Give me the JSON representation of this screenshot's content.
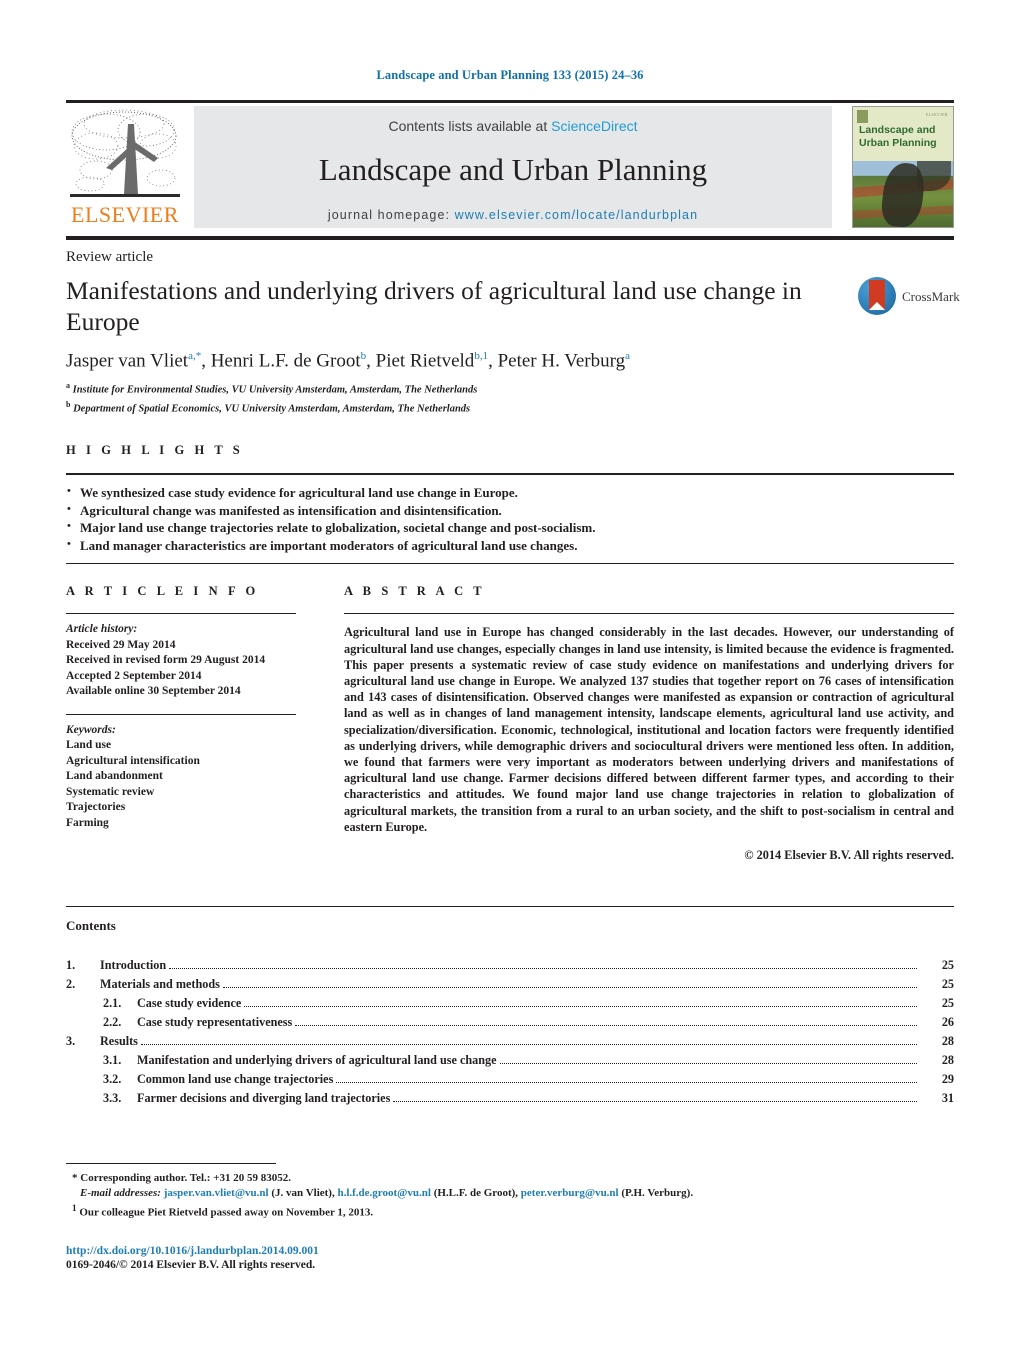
{
  "masthead": {
    "citation": "Landscape and Urban Planning 133 (2015) 24–36"
  },
  "journal_header": {
    "contents_prefix": "Contents lists available at ",
    "sciencedirect": "ScienceDirect",
    "journal_title": "Landscape and Urban Planning",
    "homepage_prefix": "journal homepage:",
    "homepage_url": "www.elsevier.com/locate/landurbplan",
    "publisher_wordmark": "ELSEVIER",
    "cover": {
      "line1": "Landscape and",
      "line2": "Urban Planning",
      "masthead_mini": "ELSEVIER"
    },
    "colors": {
      "link_blue": "#1f7db5",
      "sciencedirect_blue": "#1f9cd4",
      "elsevier_orange": "#f07c1a",
      "panel_grey": "#e6e7e8",
      "cover_green": "#2f6b2f"
    }
  },
  "article": {
    "type": "Review article",
    "title": "Manifestations and underlying drivers of agricultural land use change in Europe",
    "crossmark_label": "CrossMark",
    "authors_html": "Jasper van Vliet<sup>a,*</sup>, Henri L.F. de Groot<sup>b</sup>, Piet Rietveld<sup>b,1</sup>, Peter H. Verburg<sup>a</sup>",
    "affiliations": [
      "Institute for Environmental Studies, VU University Amsterdam, Amsterdam, The Netherlands",
      "Department of Spatial Economics, VU University Amsterdam, Amsterdam, The Netherlands"
    ],
    "affiliation_marks": [
      "a",
      "b"
    ]
  },
  "highlights": {
    "heading": "H I G H L I G H T S",
    "items": [
      "We synthesized case study evidence for agricultural land use change in Europe.",
      "Agricultural change was manifested as intensification and disintensification.",
      "Major land use change trajectories relate to globalization, societal change and post-socialism.",
      "Land manager characteristics are important moderators of agricultural land use changes."
    ]
  },
  "article_info": {
    "heading": "A R T I C L E    I N F O",
    "history_label": "Article history:",
    "history": [
      "Received 29 May 2014",
      "Received in revised form 29 August 2014",
      "Accepted 2 September 2014",
      "Available online 30 September 2014"
    ],
    "keywords_label": "Keywords:",
    "keywords": [
      "Land use",
      "Agricultural intensification",
      "Land abandonment",
      "Systematic review",
      "Trajectories",
      "Farming"
    ]
  },
  "abstract": {
    "heading": "A B S T R A C T",
    "text": "Agricultural land use in Europe has changed considerably in the last decades. However, our understanding of agricultural land use changes, especially changes in land use intensity, is limited because the evidence is fragmented. This paper presents a systematic review of case study evidence on manifestations and underlying drivers for agricultural land use change in Europe. We analyzed 137 studies that together report on 76 cases of intensification and 143 cases of disintensification. Observed changes were manifested as expansion or contraction of agricultural land as well as in changes of land management intensity, landscape elements, agricultural land use activity, and specialization/diversification. Economic, technological, institutional and location factors were frequently identified as underlying drivers, while demographic drivers and sociocultural drivers were mentioned less often. In addition, we found that farmers were very important as moderators between underlying drivers and manifestations of agricultural land use change. Farmer decisions differed between different farmer types, and according to their characteristics and attitudes. We found major land use change trajectories in relation to globalization of agricultural markets, the transition from a rural to an urban society, and the shift to post-socialism in central and eastern Europe.",
    "copyright": "© 2014 Elsevier B.V. All rights reserved."
  },
  "contents": {
    "heading": "Contents",
    "entries": [
      {
        "num": "1.",
        "label": "Introduction",
        "page": "25",
        "sub": false
      },
      {
        "num": "2.",
        "label": "Materials and methods",
        "page": "25",
        "sub": false
      },
      {
        "num": "2.1.",
        "label": "Case study evidence",
        "page": "25",
        "sub": true
      },
      {
        "num": "2.2.",
        "label": "Case study representativeness",
        "page": "26",
        "sub": true
      },
      {
        "num": "3.",
        "label": "Results",
        "page": "28",
        "sub": false
      },
      {
        "num": "3.1.",
        "label": "Manifestation and underlying drivers of agricultural land use change",
        "page": "28",
        "sub": true
      },
      {
        "num": "3.2.",
        "label": "Common land use change trajectories",
        "page": "29",
        "sub": true
      },
      {
        "num": "3.3.",
        "label": "Farmer decisions and diverging land trajectories",
        "page": "31",
        "sub": true
      }
    ]
  },
  "footnotes": {
    "corresponding": "Corresponding author. Tel.: +31 20 59 83052.",
    "corresponding_mark": "*",
    "email_label": "E-mail addresses:",
    "emails": [
      {
        "address": "jasper.van.vliet@vu.nl",
        "person": "(J. van Vliet),"
      },
      {
        "address": "h.l.f.de.groot@vu.nl",
        "person": "(H.L.F. de Groot),"
      },
      {
        "address": "peter.verburg@vu.nl",
        "person": "(P.H. Verburg)."
      }
    ],
    "note_mark": "1",
    "note": "Our colleague Piet Rietveld passed away on November 1, 2013.",
    "doi": "http://dx.doi.org/10.1016/j.landurbplan.2014.09.001",
    "issn_line": "0169-2046/© 2014 Elsevier B.V. All rights reserved."
  }
}
